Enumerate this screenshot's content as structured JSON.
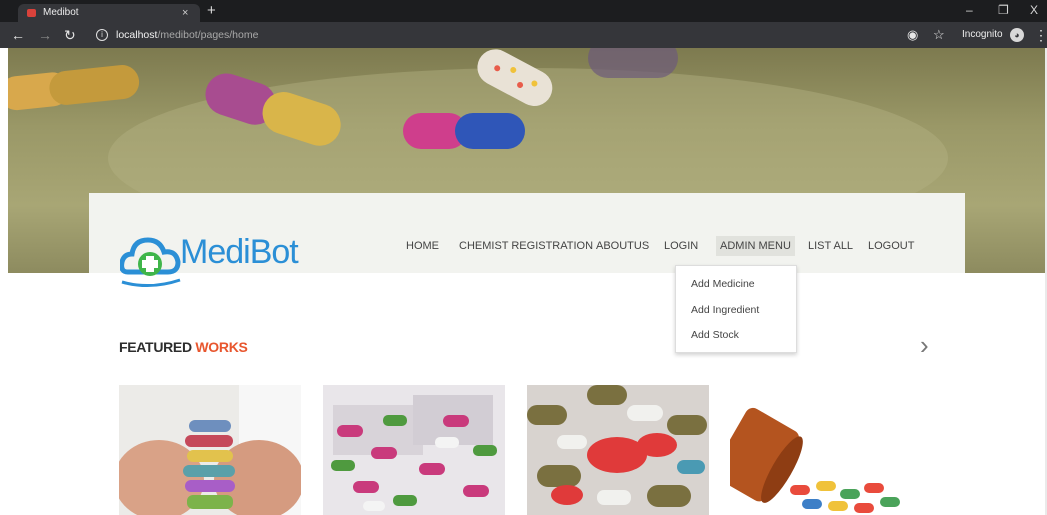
{
  "browser": {
    "tab_title": "Medibot",
    "tab_close": "×",
    "new_tab": "+",
    "url_host": "localhost",
    "url_path": "/medibot/pages/home",
    "incognito_label": "Incognito",
    "window_minimize": "–",
    "window_restore": "❐",
    "window_close": "X"
  },
  "site": {
    "logo_text": "MediBot",
    "nav": [
      {
        "label": "HOME"
      },
      {
        "label": "CHEMIST REGISTRATION"
      },
      {
        "label": "ABOUTUS"
      },
      {
        "label": "LOGIN"
      },
      {
        "label": "ADMIN MENU"
      },
      {
        "label": "LIST ALL"
      },
      {
        "label": "LOGOUT"
      }
    ],
    "admin_menu": [
      {
        "label": "Add Medicine"
      },
      {
        "label": "Add Ingredient"
      },
      {
        "label": "Add Stock"
      }
    ],
    "section_title_part1": "FEATURED ",
    "section_title_part2": "WORKS",
    "next_arrow": "›"
  },
  "colors": {
    "accent": "#e8562e",
    "logo_blue": "#2b8fd6",
    "chrome_dark": "#35363a"
  }
}
